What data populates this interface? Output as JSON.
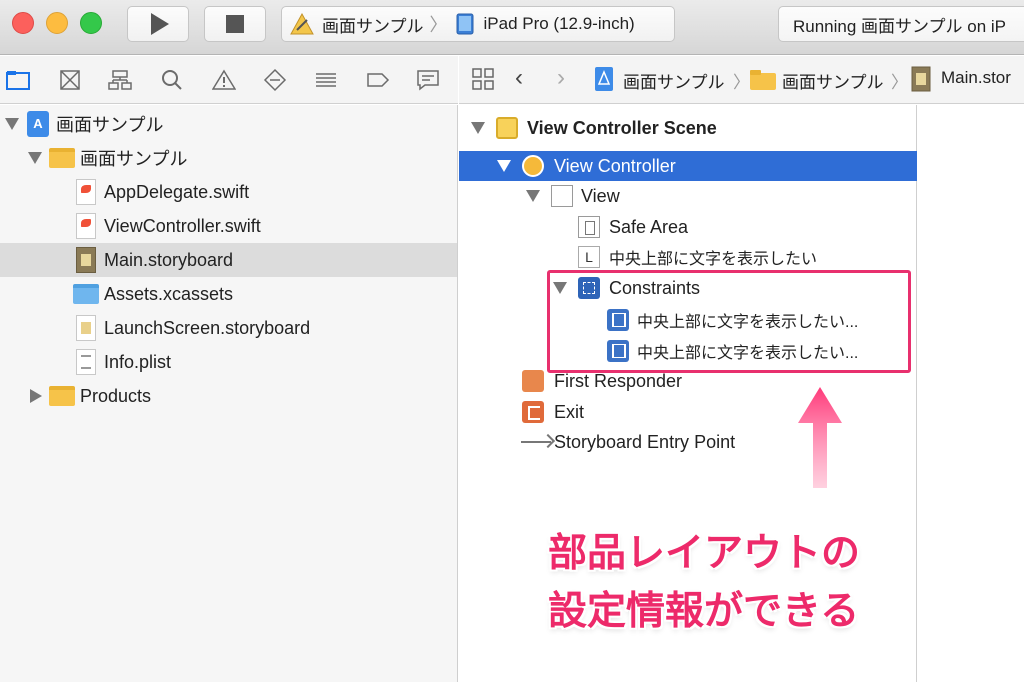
{
  "titlebar": {
    "scheme": {
      "project": "画面サンプル",
      "device": "iPad Pro (12.9-inch)"
    },
    "status": "Running 画面サンプル on iP"
  },
  "navigator_icons": [
    "folder-icon",
    "source-control-icon",
    "hierarchy-icon",
    "search-icon",
    "warning-icon",
    "test-icon",
    "debug-icon",
    "breakpoint-icon",
    "report-icon"
  ],
  "file_tree": {
    "project": "画面サンプル",
    "group": "画面サンプル",
    "files": [
      "AppDelegate.swift",
      "ViewController.swift",
      "Main.storyboard",
      "Assets.xcassets",
      "LaunchScreen.storyboard",
      "Info.plist"
    ],
    "products": "Products"
  },
  "jumpbar": {
    "items": [
      "画面サンプル",
      "画面サンプル",
      "Main.stor"
    ]
  },
  "outline": {
    "scene": "View Controller Scene",
    "view_controller": "View Controller",
    "view": "View",
    "safe_area": "Safe Area",
    "label_item": "中央上部に文字を表示したい",
    "constraints": "Constraints",
    "constraint_1": "中央上部に文字を表示したい...",
    "constraint_2": "中央上部に文字を表示したい...",
    "first_responder": "First Responder",
    "exit": "Exit",
    "entry_point": "Storyboard Entry Point"
  },
  "annotation": {
    "line1": "部品レイアウトの",
    "line2": "設定情報ができる",
    "color": "#ed2a6a"
  },
  "colors": {
    "selection": "#2f6dd6",
    "highlight": "#e8306e"
  }
}
